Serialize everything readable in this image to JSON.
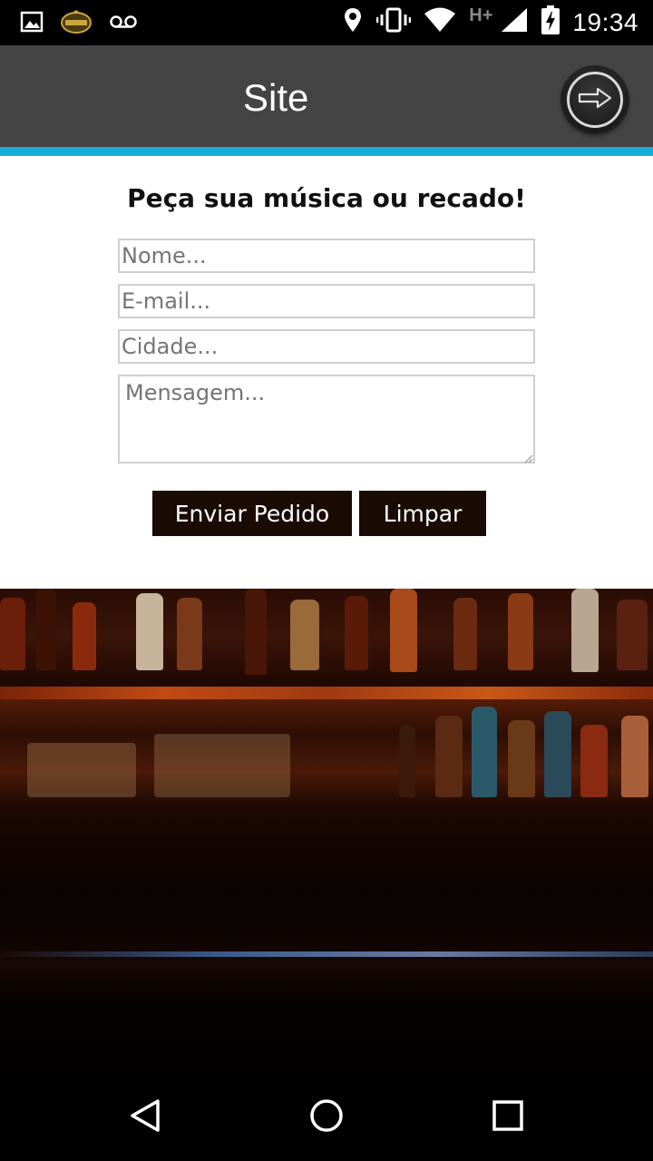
{
  "status_bar": {
    "time": "19:34",
    "network": "H+",
    "left_icons": [
      "image-icon",
      "app-logo-icon",
      "voicemail-icon"
    ],
    "right_icons": [
      "location-icon",
      "vibrate-icon",
      "wifi-icon",
      "signal-icon",
      "battery-charging-icon"
    ]
  },
  "app_bar": {
    "title": "Site",
    "action_icon": "arrow-right-icon",
    "accent_color": "#15b0d8"
  },
  "form": {
    "title": "Peça sua música ou recado!",
    "name_placeholder": "Nome...",
    "email_placeholder": "E-mail...",
    "city_placeholder": "Cidade...",
    "message_placeholder": "Mensagem...",
    "submit_label": "Enviar Pedido",
    "clear_label": "Limpar",
    "button_color": "#1a0c04"
  },
  "nav_bar": {
    "icons": [
      "back-icon",
      "home-icon",
      "recents-icon"
    ]
  }
}
